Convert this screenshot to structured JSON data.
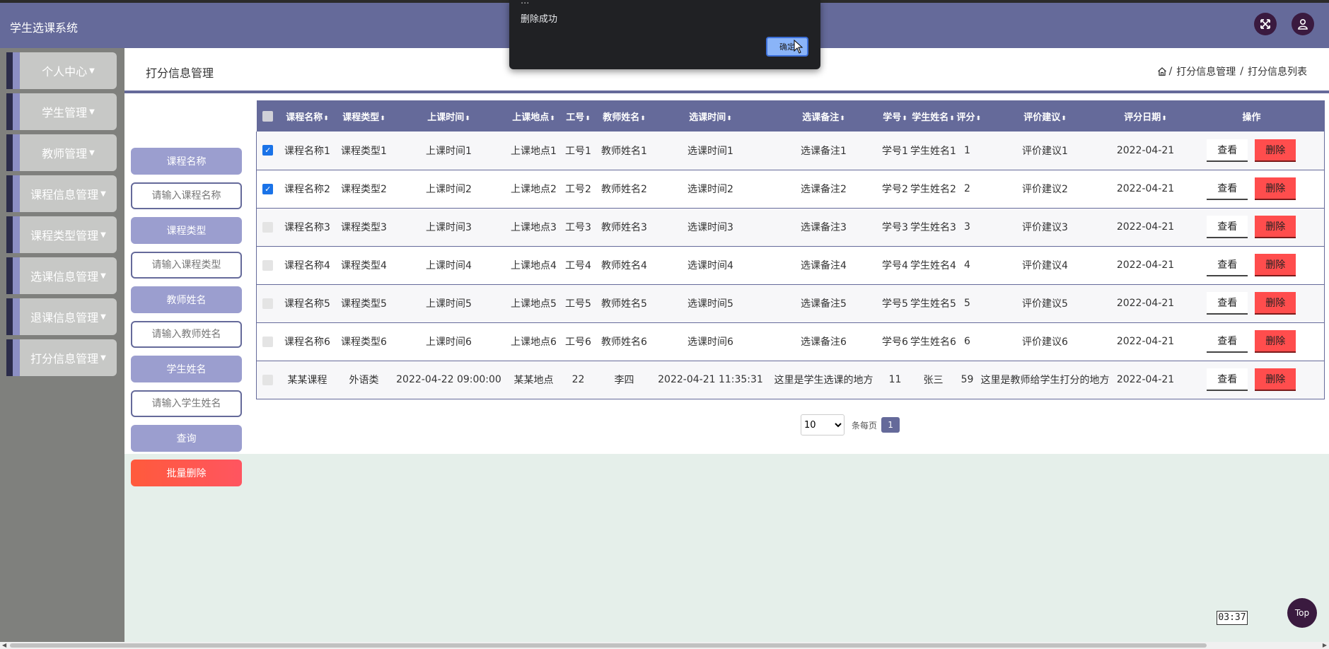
{
  "app": {
    "title": "学生选课系统"
  },
  "header": {
    "fullscreen_icon": "expand-arrows-icon",
    "user_icon": "user-icon"
  },
  "sidebar": {
    "items": [
      {
        "label": "个人中心"
      },
      {
        "label": "学生管理"
      },
      {
        "label": "教师管理"
      },
      {
        "label": "课程信息管理"
      },
      {
        "label": "课程类型管理"
      },
      {
        "label": "选课信息管理"
      },
      {
        "label": "退课信息管理"
      },
      {
        "label": "打分信息管理"
      }
    ]
  },
  "page": {
    "title": "打分信息管理",
    "breadcrumb": [
      "打分信息管理",
      "打分信息列表"
    ],
    "home_icon": "home-icon"
  },
  "search": {
    "fields": [
      {
        "label": "课程名称",
        "placeholder": "请输入课程名称"
      },
      {
        "label": "课程类型",
        "placeholder": "请输入课程类型"
      },
      {
        "label": "教师姓名",
        "placeholder": "请输入教师姓名"
      },
      {
        "label": "学生姓名",
        "placeholder": "请输入学生姓名"
      }
    ],
    "query_label": "查询",
    "batch_delete_label": "批量删除"
  },
  "table": {
    "headers": [
      "课程名称",
      "课程类型",
      "上课时间",
      "上课地点",
      "工号",
      "教师姓名",
      "选课时间",
      "选课备注",
      "学号",
      "学生姓名",
      "评分",
      "评价建议",
      "评分日期",
      "操作"
    ],
    "view_label": "查看",
    "delete_label": "删除",
    "rows": [
      {
        "checked": true,
        "cells": [
          "课程名称1",
          "课程类型1",
          "上课时间1",
          "上课地点1",
          "工号1",
          "教师姓名1",
          "选课时间1",
          "选课备注1",
          "学号1",
          "学生姓名1",
          "1",
          "评价建议1",
          "2022-04-21"
        ]
      },
      {
        "checked": true,
        "cells": [
          "课程名称2",
          "课程类型2",
          "上课时间2",
          "上课地点2",
          "工号2",
          "教师姓名2",
          "选课时间2",
          "选课备注2",
          "学号2",
          "学生姓名2",
          "2",
          "评价建议2",
          "2022-04-21"
        ]
      },
      {
        "checked": false,
        "cells": [
          "课程名称3",
          "课程类型3",
          "上课时间3",
          "上课地点3",
          "工号3",
          "教师姓名3",
          "选课时间3",
          "选课备注3",
          "学号3",
          "学生姓名3",
          "3",
          "评价建议3",
          "2022-04-21"
        ]
      },
      {
        "checked": false,
        "cells": [
          "课程名称4",
          "课程类型4",
          "上课时间4",
          "上课地点4",
          "工号4",
          "教师姓名4",
          "选课时间4",
          "选课备注4",
          "学号4",
          "学生姓名4",
          "4",
          "评价建议4",
          "2022-04-21"
        ]
      },
      {
        "checked": false,
        "cells": [
          "课程名称5",
          "课程类型5",
          "上课时间5",
          "上课地点5",
          "工号5",
          "教师姓名5",
          "选课时间5",
          "选课备注5",
          "学号5",
          "学生姓名5",
          "5",
          "评价建议5",
          "2022-04-21"
        ]
      },
      {
        "checked": false,
        "cells": [
          "课程名称6",
          "课程类型6",
          "上课时间6",
          "上课地点6",
          "工号6",
          "教师姓名6",
          "选课时间6",
          "选课备注6",
          "学号6",
          "学生姓名6",
          "6",
          "评价建议6",
          "2022-04-21"
        ]
      },
      {
        "checked": false,
        "cells": [
          "某某课程",
          "外语类",
          "2022-04-22 09:00:00",
          "某某地点",
          "22",
          "李四",
          "2022-04-21 11:35:31",
          "这里是学生选课的地方",
          "11",
          "张三",
          "59",
          "这里是教师给学生打分的地方",
          "2022-04-21"
        ]
      }
    ]
  },
  "pagination": {
    "page_size": "10",
    "page_size_options": [
      "10"
    ],
    "per_page_label": "条每页",
    "current_page": "1"
  },
  "dialog": {
    "title": "...",
    "message": "删除成功",
    "ok_label": "确定"
  },
  "timer": "03:37",
  "top_button": "Top",
  "colors": {
    "primary": "#656a9a",
    "accent": "#9b9ecf",
    "danger": "#ff4d4d",
    "query": "#9b9ecf",
    "batch_delete": "#ff5a3c",
    "dark": "#3a1a3f"
  }
}
